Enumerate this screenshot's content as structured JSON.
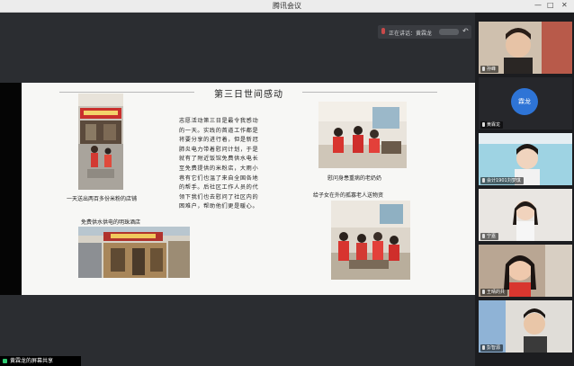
{
  "window": {
    "title": "腾讯会议",
    "controls": [
      "—",
      "□",
      "✕"
    ]
  },
  "speaking": {
    "label": "正在讲话：黄霖龙"
  },
  "document": {
    "title": "第三日世间感动",
    "captions": {
      "shop": "一天送出两百多份米粉的店铺",
      "free_water": "免费供水供电的明珠酒店",
      "elder_sick": "慰问身患重病的老奶奶",
      "lonely_elder": "给子女在外的孤寡老人送物资"
    },
    "paragraph": "志愿活动第三日是最令我感动的一天。实践的首道工作都是将要分享的进行着，但是新冠肺炎电力带着慰问计划，于是就有了附近饭馆免费供水电长至免费提供的米粉店，大雨小巷有它们也温了来自全国各地的帮手。后社区工作人员的代领下我们也去慰问了社区内的困难户，帮助他们更是暖心。"
  },
  "sharebar": {
    "label": "黄霖龙的屏幕共享"
  },
  "participants": [
    {
      "name": "孙峰",
      "type": "video"
    },
    {
      "name": "黄霖龙",
      "type": "avatar",
      "avatar_text": "霖龙"
    },
    {
      "name": "会计1901刘梦琪",
      "type": "video"
    },
    {
      "name": "宁嘉",
      "type": "video"
    },
    {
      "name": "王晴的共",
      "type": "video"
    },
    {
      "name": "彭智源",
      "type": "video"
    }
  ],
  "colors": {
    "accent": "#2e74d6",
    "stage": "#2b2d31",
    "paper": "#f7f7f5"
  }
}
